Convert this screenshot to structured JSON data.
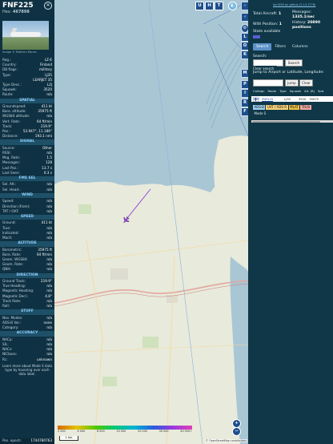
{
  "aircraft": {
    "callsign": "FNF225",
    "hex_label": "Hex:",
    "hex": "467898",
    "photo_credit": "Image © Mathieu Ronan",
    "close_icon": "close-icon",
    "details": [
      {
        "k": "Reg.:",
        "v": "LZ-E"
      },
      {
        "k": "Country:",
        "v": "Finland"
      },
      {
        "k": "DB flags:",
        "v": "military"
      },
      {
        "k": "Type:",
        "v": "LJ35"
      },
      {
        "k": "",
        "v": "LEARJET 35"
      },
      {
        "k": "Type Desc.:",
        "v": "L2J"
      },
      {
        "k": "Squawk:",
        "v": "3520"
      },
      {
        "k": "Route:",
        "v": "n/a"
      }
    ],
    "sections": [
      {
        "title": "SPATIAL",
        "rows": [
          {
            "k": "Groundspeed:",
            "v": "411 kt"
          },
          {
            "k": "Baro. altitude:",
            "v": "35975 ft"
          },
          {
            "k": "WGS84 altitude:",
            "v": "n/a"
          },
          {
            "k": "Vert. Rate:",
            "v": "64 ft/min"
          },
          {
            "k": "Track:",
            "v": "219.9°"
          },
          {
            "k": "Pos.:",
            "v": "53.947°, 11.186°"
          },
          {
            "k": "Distance:",
            "v": "193.1 nmi"
          }
        ]
      },
      {
        "title": "SIGNAL",
        "rows": [
          {
            "k": "Source:",
            "v": "Other"
          },
          {
            "k": "RSSI:",
            "v": "n/a"
          },
          {
            "k": "Msg. Rate:",
            "v": "1.5"
          },
          {
            "k": "Messages:",
            "v": "128"
          },
          {
            "k": "Last Pos.:",
            "v": "13.7 s"
          },
          {
            "k": "Last Seen:",
            "v": "0.3 s"
          }
        ]
      },
      {
        "title": "FMS SEL",
        "rows": [
          {
            "k": "Sel. Alt.:",
            "v": "n/a"
          },
          {
            "k": "Sel. Head.:",
            "v": "n/a"
          }
        ]
      },
      {
        "title": "WIND",
        "rows": [
          {
            "k": "Speed:",
            "v": "n/a"
          },
          {
            "k": "Direction (from):",
            "v": "n/a"
          },
          {
            "k": "TAT / OAT:",
            "v": "n/a"
          }
        ]
      },
      {
        "title": "SPEED",
        "rows": [
          {
            "k": "Ground:",
            "v": "411 kt"
          },
          {
            "k": "True:",
            "v": "n/a"
          },
          {
            "k": "Indicated:",
            "v": "n/a"
          },
          {
            "k": "Mach:",
            "v": "n/a"
          }
        ]
      },
      {
        "title": "ALTITUDE",
        "rows": [
          {
            "k": "Barometric:",
            "v": "35975 ft"
          },
          {
            "k": "Baro. Rate:",
            "v": "64 ft/min"
          },
          {
            "k": "Geom. WGS84:",
            "v": "n/a"
          },
          {
            "k": "Geom. Rate:",
            "v": "n/a"
          },
          {
            "k": "QNH:",
            "v": "n/a"
          }
        ]
      },
      {
        "title": "DIRECTION",
        "rows": [
          {
            "k": "Ground Track:",
            "v": "219.9°"
          },
          {
            "k": "True Heading:",
            "v": "n/a"
          },
          {
            "k": "Magnetic Heading:",
            "v": "n/a"
          },
          {
            "k": "Magnetic Decl.:",
            "v": "4.8°"
          },
          {
            "k": "Track Rate:",
            "v": "n/a"
          },
          {
            "k": "Roll:",
            "v": "n/a"
          }
        ]
      },
      {
        "title": "STUFF",
        "rows": [
          {
            "k": "Nav. Modes:",
            "v": "n/a"
          },
          {
            "k": "ADS-B Ver.:",
            "v": "none"
          },
          {
            "k": "Category:",
            "v": "n/a"
          }
        ]
      },
      {
        "title": "ACCURACY",
        "rows": [
          {
            "k": "NACp:",
            "v": "n/a"
          },
          {
            "k": "SIL:",
            "v": "n/a"
          },
          {
            "k": "NACv:",
            "v": "n/a"
          },
          {
            "k": "NICbaro:",
            "v": "n/a"
          },
          {
            "k": "Rc:",
            "v": "unknown"
          }
        ]
      }
    ],
    "footer": "Learn more about Mode S data type by hovering over each data label.",
    "pos_epoch_label": "Pos. epoch:",
    "pos_epoch": "1744780763"
  },
  "map": {
    "top_buttons": [
      "U",
      "H",
      "T"
    ],
    "side_buttons": [
      "L",
      "O",
      "K",
      "M",
      "P",
      "I",
      "R",
      "F"
    ],
    "scale_label": "1 km",
    "attribution": "© OpenStreetMap contributors",
    "zoom_in": "+",
    "zoom_out": "−",
    "altitude_ticks": [
      "2 000",
      "6 000",
      "8 000",
      "10 000",
      "20 000",
      "30 000",
      "40 000+"
    ]
  },
  "stats": {
    "version_link": "tar1090 on github (3.14.1778)",
    "total_label": "Total Aircraft:",
    "total": "1",
    "messages_label": "Messages:",
    "messages": "1335.1/sec",
    "with_pos_label": "With Position:",
    "with_pos": "1",
    "history_label": "History:",
    "history": "20890 positions",
    "state_label": "State available"
  },
  "tabs": [
    {
      "label": "Search",
      "active": true
    },
    {
      "label": "Filters",
      "active": false
    },
    {
      "label": "Columns",
      "active": false
    }
  ],
  "search": {
    "label": "Search:",
    "search_btn": "Search",
    "clear_btn": "Clear search",
    "jump_label": "Jump to Airport or Latitude, Longitude:",
    "jump_btn": "Jump",
    "clear_jump_btn": "Clear"
  },
  "table": {
    "headers": [
      "Callsign",
      "Route",
      "Type",
      "Squawk",
      "Alt. (ft)",
      "Spd."
    ],
    "row": {
      "callsign": "FNF225",
      "type": "LJ35",
      "squawk": "3520",
      "alt": "35975"
    }
  },
  "legend": [
    {
      "label": "ADS-B",
      "color": "#9fd0f0"
    },
    {
      "label": "UAT / ADS-R",
      "color": "#f5d37a"
    },
    {
      "label": "MLAT",
      "color": "#f0c040"
    },
    {
      "label": "TIS-B",
      "color": "#f2a7a0"
    },
    {
      "label": "Mode S",
      "color": "#bfbfbf"
    }
  ],
  "colors": {
    "panel_bg": "#0e3143",
    "section_bg": "#1e5068",
    "accent_blue": "#1d4f8c",
    "sea": "#a9c6d4",
    "land": "#e8eadb",
    "aircraft": "#8a3fd6"
  }
}
